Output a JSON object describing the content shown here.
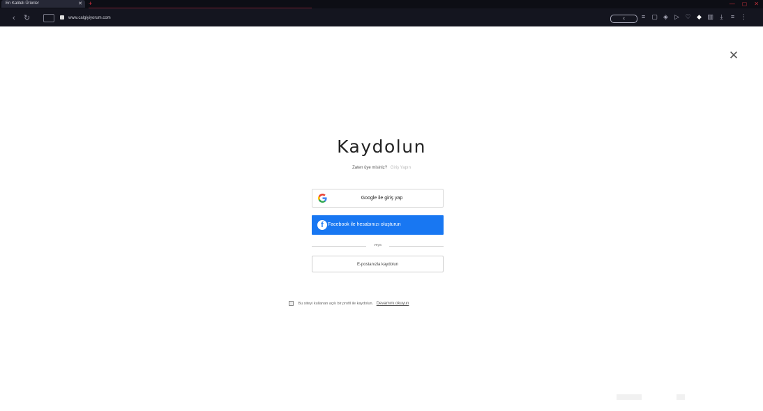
{
  "browser": {
    "tab_title": "En Kaliteli Ürünler",
    "tab_close": "✕",
    "new_tab": "+",
    "url": "www.calgiyiyorum.com",
    "extensions_pill": "x",
    "window_controls": [
      "—",
      "▢",
      "✕"
    ]
  },
  "page": {
    "close_icon": "✕",
    "title": "Kaydolun",
    "subtitle_text": "Zaten üye misiniz?",
    "login_link": "Giriş Yapın",
    "google_button": "Google ile giriş yap",
    "facebook_button": "Facebook ile hesabınızı oluşturun",
    "divider_text": "veya",
    "email_button": "E-postanızla kaydolun",
    "consent_text": "Bu siteyi kullanan açık bir profil ile kaydolun.",
    "consent_more": "Devamını okuyun"
  },
  "colors": {
    "facebook_blue": "#1877f2",
    "chrome_bg": "#14151f"
  }
}
